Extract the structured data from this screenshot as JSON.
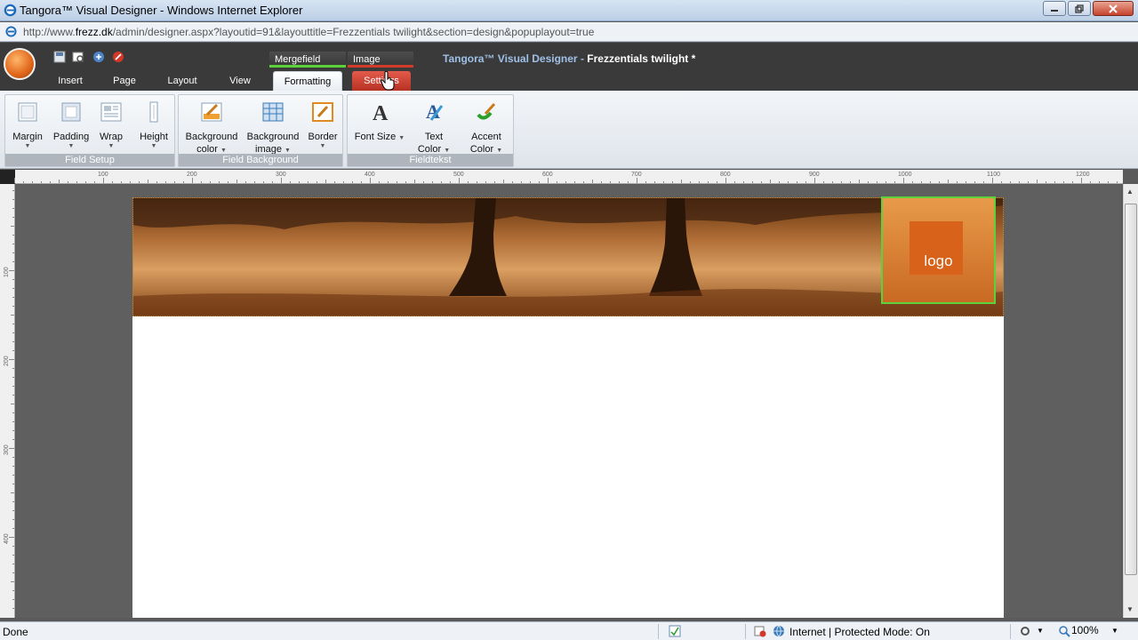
{
  "window": {
    "title": "Tangora™ Visual Designer - Windows Internet Explorer",
    "url_prefix": "http://www.",
    "url_domain": "frezz.dk",
    "url_rest": "/admin/designer.aspx?layoutid=91&layouttitle=Frezzentials twilight&section=design&popuplayout=true"
  },
  "app": {
    "title_app": "Tangora™ Visual Designer",
    "title_sep": " - ",
    "title_doc": "Frezzentials twilight *",
    "context_tabs": {
      "mergefield": "Mergefield",
      "image": "Image"
    },
    "tabs": {
      "insert": "Insert",
      "page": "Page",
      "layout": "Layout",
      "view": "View",
      "formatting": "Formatting",
      "settings": "Settings"
    },
    "active_tab": "Formatting"
  },
  "ribbon": {
    "field_setup": {
      "label": "Field Setup",
      "margin": "Margin",
      "padding": "Padding",
      "wrap": "Wrap",
      "height": "Height"
    },
    "field_background": {
      "label": "Field Background",
      "bg_color_1": "Background",
      "bg_color_2": "color",
      "bg_image_1": "Background",
      "bg_image_2": "image",
      "border": "Border"
    },
    "fieldtekst": {
      "label": "Fieldtekst",
      "font_size": "Font Size",
      "text_color_1": "Text",
      "text_color_2": "Color",
      "accent_color_1": "Accent",
      "accent_color_2": "Color"
    }
  },
  "ruler": {
    "h_labels": [
      "100",
      "200",
      "300",
      "400",
      "500",
      "600",
      "700",
      "800",
      "900",
      "1000",
      "1100",
      "1200"
    ],
    "v_labels": [
      "100",
      "200",
      "300",
      "400"
    ]
  },
  "canvas": {
    "logo_label": "logo"
  },
  "status": {
    "left": "Done",
    "zone": "Internet | Protected Mode: On",
    "zoom": "100%"
  },
  "colors": {
    "accent_green": "#5bd13a",
    "accent_red": "#d43a2a",
    "header_bg": "#3a3a3a",
    "banner_orange": "#c98a4a"
  }
}
